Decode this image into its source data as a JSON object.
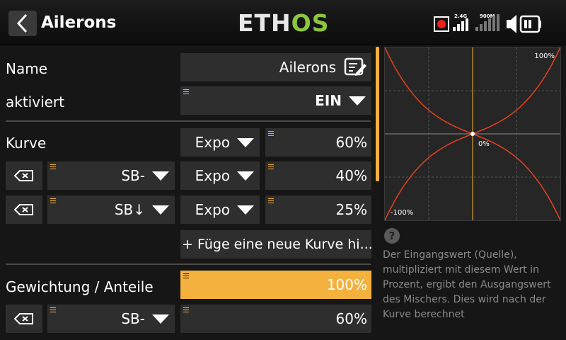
{
  "header": {
    "title": "Ailerons",
    "logo_left": "ETH",
    "logo_right": "OS",
    "rx1_label": "2.4G",
    "rx2_label": "900M"
  },
  "form": {
    "name": {
      "label": "Name",
      "value": "Ailerons"
    },
    "enabled": {
      "label": "aktiviert",
      "value": "EIN"
    },
    "curve": {
      "label": "Kurve",
      "type": "Expo",
      "value": "60%"
    },
    "curve_rows": [
      {
        "source": "SB-",
        "type": "Expo",
        "value": "40%"
      },
      {
        "source": "SB↓",
        "type": "Expo",
        "value": "25%"
      }
    ],
    "add_curve_label": "+ Füge eine neue Kurve hi...",
    "weight": {
      "label": "Gewichtung / Anteile",
      "value": "100%"
    },
    "weight_rows": [
      {
        "source": "SB-",
        "value": "60%"
      }
    ]
  },
  "graph": {
    "top_label": "100%",
    "center_label": "0%",
    "bottom_label": "-100%",
    "expo_percent": 60,
    "curve_color": "#e8401e",
    "axis_color": "#f4b13d"
  },
  "help": {
    "text": "Der Eingangswert (Quelle), multipliziert mit diesem Wert in Prozent, ergibt den Ausgangswert des Mischers. Dies wird nach der Kurve berechnet"
  },
  "colors": {
    "accent": "#f4b13d",
    "logo_green": "#8cc63f",
    "field_bg": "#2e2e2e",
    "background": "#161616"
  }
}
